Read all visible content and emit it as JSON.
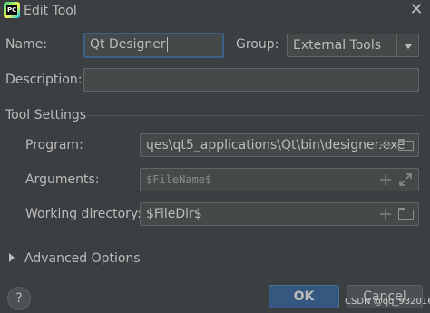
{
  "window": {
    "title": "Edit Tool",
    "app_icon_text": "PC",
    "close_glyph": "✕"
  },
  "form": {
    "name_label": "Name:",
    "name_value": "Qt Designer",
    "group_label": "Group:",
    "group_value": "External Tools",
    "description_label": "Description:",
    "description_value": ""
  },
  "tool_settings": {
    "section_label": "Tool Settings",
    "program_label": "Program:",
    "program_value": "ɥes\\qt5_applications\\Qt\\bin\\designer.exe",
    "arguments_label": "Arguments:",
    "arguments_value": "$FileName$",
    "working_dir_label": "Working directory:",
    "working_dir_value": "$FileDir$"
  },
  "advanced": {
    "label": "Advanced Options"
  },
  "footer": {
    "help_label": "?",
    "ok_label": "OK",
    "cancel_label": "Cancel",
    "watermark": "CSDN @qq_932016561"
  },
  "colors": {
    "background": "#3c3f41",
    "field_bg": "#45494a",
    "focus_border": "#3d6185",
    "ok_button": "#365880",
    "text": "#bbbbbb"
  },
  "icons": [
    "app-icon",
    "close-icon",
    "dropdown-arrow-icon",
    "plus-icon",
    "folder-icon",
    "expand-icon",
    "chevron-right-icon",
    "help-icon"
  ]
}
